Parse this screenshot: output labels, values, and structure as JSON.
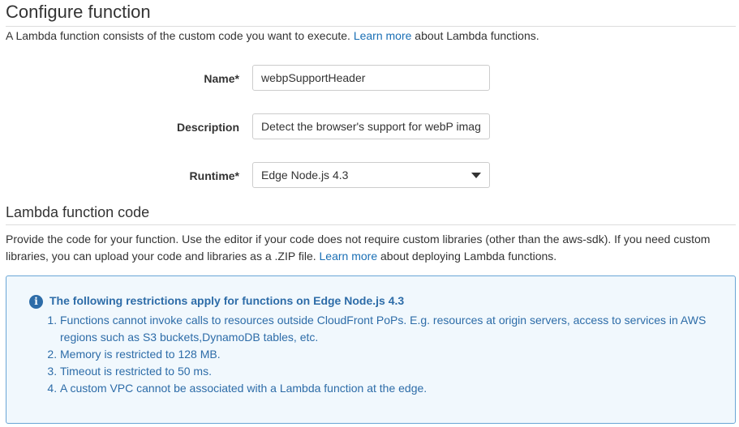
{
  "configure": {
    "title": "Configure function",
    "desc_pre": "A Lambda function consists of the custom code you want to execute.",
    "desc_link": "Learn more",
    "desc_post": "about Lambda functions."
  },
  "form": {
    "name_label": "Name*",
    "name_value": "webpSupportHeader",
    "description_label": "Description",
    "description_value": "Detect the browser's support for webP images",
    "runtime_label": "Runtime*",
    "runtime_value": "Edge Node.js 4.3"
  },
  "code_section": {
    "title": "Lambda function code",
    "desc_pre_line1": "Provide the code for your function. Use the editor if your code does not require custom libraries (other than the aws-sdk). If you need custom",
    "desc_pre_line2": "libraries, you can upload your code and libraries as a .ZIP file.",
    "desc_link": "Learn more",
    "desc_post": "about deploying Lambda functions."
  },
  "restrictions": {
    "heading": "The following restrictions apply for functions on Edge Node.js 4.3",
    "items": [
      "Functions cannot invoke calls to resources outside CloudFront PoPs. E.g. resources at origin servers, access to services in AWS regions such as S3 buckets,DynamoDB tables, etc.",
      "Memory is restricted to 128 MB.",
      "Timeout is restricted to 50 ms.",
      "A custom VPC cannot be associated with a Lambda function at the edge."
    ]
  },
  "colors": {
    "link": "#1a6fb5",
    "info_text": "#2d6ca8",
    "info_border": "#6aa6d6",
    "info_background": "#f1f8fd"
  },
  "icons": {
    "info": "info-circle-icon",
    "dropdown": "caret-down-icon"
  }
}
